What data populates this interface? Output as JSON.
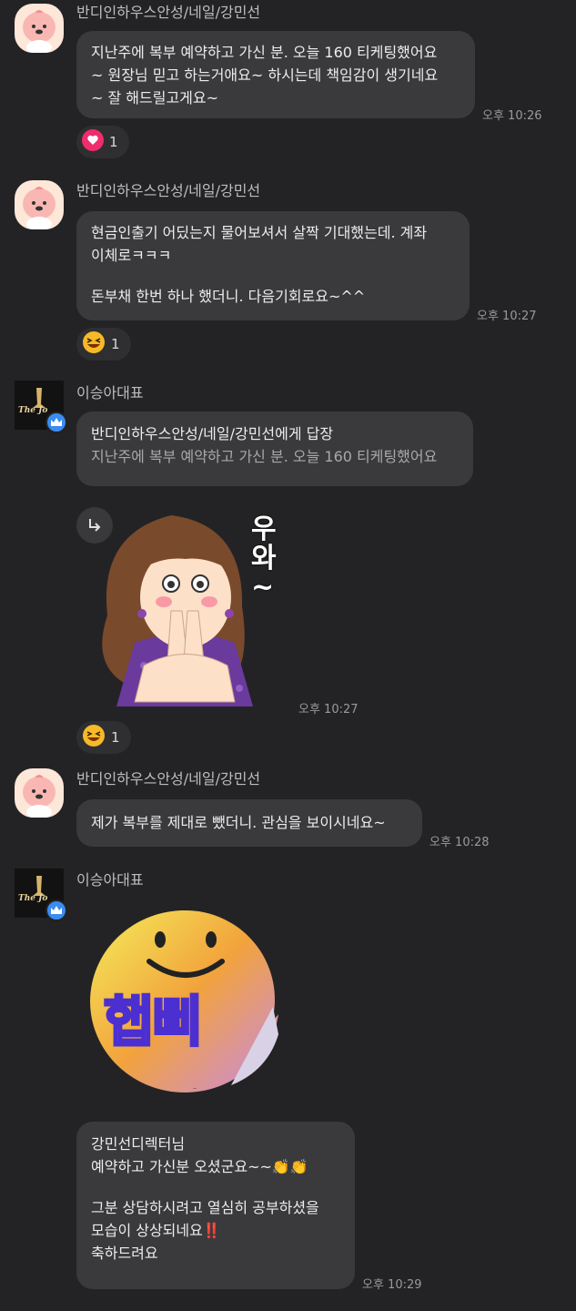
{
  "messages": [
    {
      "sender": "반디인하우스안성/네일/강민선",
      "lines": [
        "지난주에 복부 예약하고 가신 분. 오늘 160 티케팅했어요",
        "~ 원장님 믿고 하는거애요~ 하시는데 책임감이 생기네요",
        "~ 잘 해드릴고게요~"
      ],
      "time": "오후 10:26",
      "reaction": {
        "icon": "heart-icon",
        "count": "1"
      }
    },
    {
      "sender": "반디인하우스안성/네일/강민선",
      "lines": [
        "현금인출기 어딨는지 물어보셔서 살짝 기대했는데. 계좌",
        "이체로ㅋㅋㅋ",
        "",
        "돈부채 한번 하나 했더니. 다음기회로요~^^"
      ],
      "time": "오후 10:27",
      "reaction": {
        "icon": "grinning-squint-emoji",
        "count": "1"
      }
    },
    {
      "sender": "이승아대표",
      "reply_to": "반디인하우스안성/네일/강민선에게 답장",
      "reply_quote": "지난주에 복부 예약하고 가신 분. 오늘 160 티케팅했어요",
      "sticker_text": [
        "우",
        "와",
        "~"
      ],
      "time": "오후 10:27",
      "reaction": {
        "icon": "grinning-squint-emoji",
        "count": "1"
      }
    },
    {
      "sender": "반디인하우스안성/네일/강민선",
      "lines": [
        "제가 복부를 제대로 뺐더니. 관심을 보이시네요~"
      ],
      "time": "오후 10:28"
    },
    {
      "sender": "이승아대표",
      "sticker_text": "햅삐",
      "lines": [
        "강민선디렉터님",
        "예약하고 가신분 오셨군요~~👏👏",
        "",
        "그분 상담하시려고 열심히 공부하셨을",
        "모습이 상상되네요‼️",
        "축하드려요"
      ],
      "time": "오후 10:29"
    }
  ],
  "avatar_logo_text": "The Jo",
  "colors": {
    "background": "#232325",
    "bubble": "#3a3a3d",
    "badge": "#3b8cf0",
    "heart": "#ef2d6c"
  }
}
